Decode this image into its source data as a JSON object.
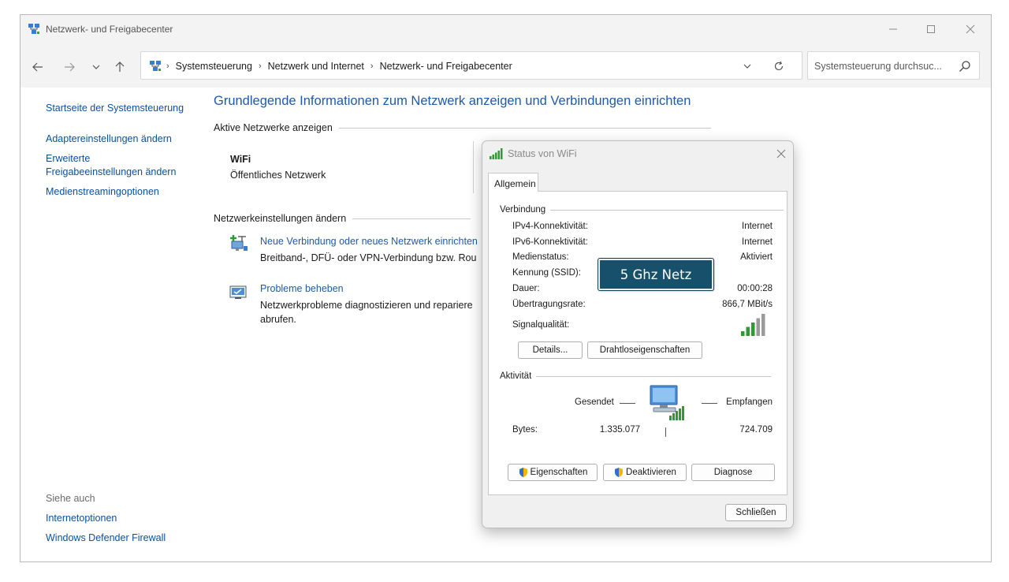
{
  "window": {
    "title": "Netzwerk- und Freigabecenter"
  },
  "address": {
    "crumbs": [
      "Systemsteuerung",
      "Netzwerk und Internet",
      "Netzwerk- und Freigabecenter"
    ],
    "search_placeholder": "Systemsteuerung durchsuc..."
  },
  "sidebar": {
    "items": [
      {
        "label": "Startseite der Systemsteuerung"
      },
      {
        "label": "Adaptereinstellungen ändern"
      },
      {
        "label": "Erweiterte Freigabeeinstellungen ändern"
      },
      {
        "label": "Medienstreamingoptionen"
      }
    ],
    "see_also_label": "Siehe auch",
    "see_also": [
      {
        "label": "Internetoptionen"
      },
      {
        "label": "Windows Defender Firewall"
      }
    ]
  },
  "main": {
    "title": "Grundlegende Informationen zum Netzwerk anzeigen und Verbindungen einrichten",
    "active_networks_heading": "Aktive Netzwerke anzeigen",
    "network_name": "WiFi",
    "network_type": "Öffentliches Netzwerk",
    "settings_heading": "Netzwerkeinstellungen ändern",
    "tasks": [
      {
        "title": "Neue Verbindung oder neues Netzwerk einrichten",
        "desc": "Breitband-, DFÜ- oder VPN-Verbindung bzw. Rou"
      },
      {
        "title": "Probleme beheben",
        "desc": "Netzwerkprobleme diagnostizieren und repariere",
        "desc2": "abrufen."
      }
    ]
  },
  "dialog": {
    "title": "Status von WiFi",
    "tab": "Allgemein",
    "connection_heading": "Verbindung",
    "rows": [
      {
        "label": "IPv4-Konnektivität:",
        "value": "Internet"
      },
      {
        "label": "IPv6-Konnektivität:",
        "value": "Internet"
      },
      {
        "label": "Medienstatus:",
        "value": "Aktiviert"
      },
      {
        "label": "Kennung (SSID):",
        "value": ""
      },
      {
        "label": "Dauer:",
        "value": "00:00:28"
      },
      {
        "label": "Übertragungsrate:",
        "value": "866,7 MBit/s"
      }
    ],
    "signal_label": "Signalqualität:",
    "signal_bars": 5,
    "details_button": "Details...",
    "wireless_button": "Drahtloseigenschaften",
    "activity_heading": "Aktivität",
    "sent_label": "Gesendet",
    "received_label": "Empfangen",
    "bytes_label": "Bytes:",
    "bytes_sent": "1.335.077",
    "bytes_received": "724.709",
    "properties_button": "Eigenschaften",
    "disable_button": "Deaktivieren",
    "diagnose_button": "Diagnose",
    "close_button": "Schließen"
  },
  "callout": {
    "text": "5 Ghz Netz"
  },
  "colors": {
    "link": "#0a4f9c",
    "title_blue": "#1e5aa8",
    "callout_bg": "#16506a",
    "signal_green": "#2f9a35"
  }
}
